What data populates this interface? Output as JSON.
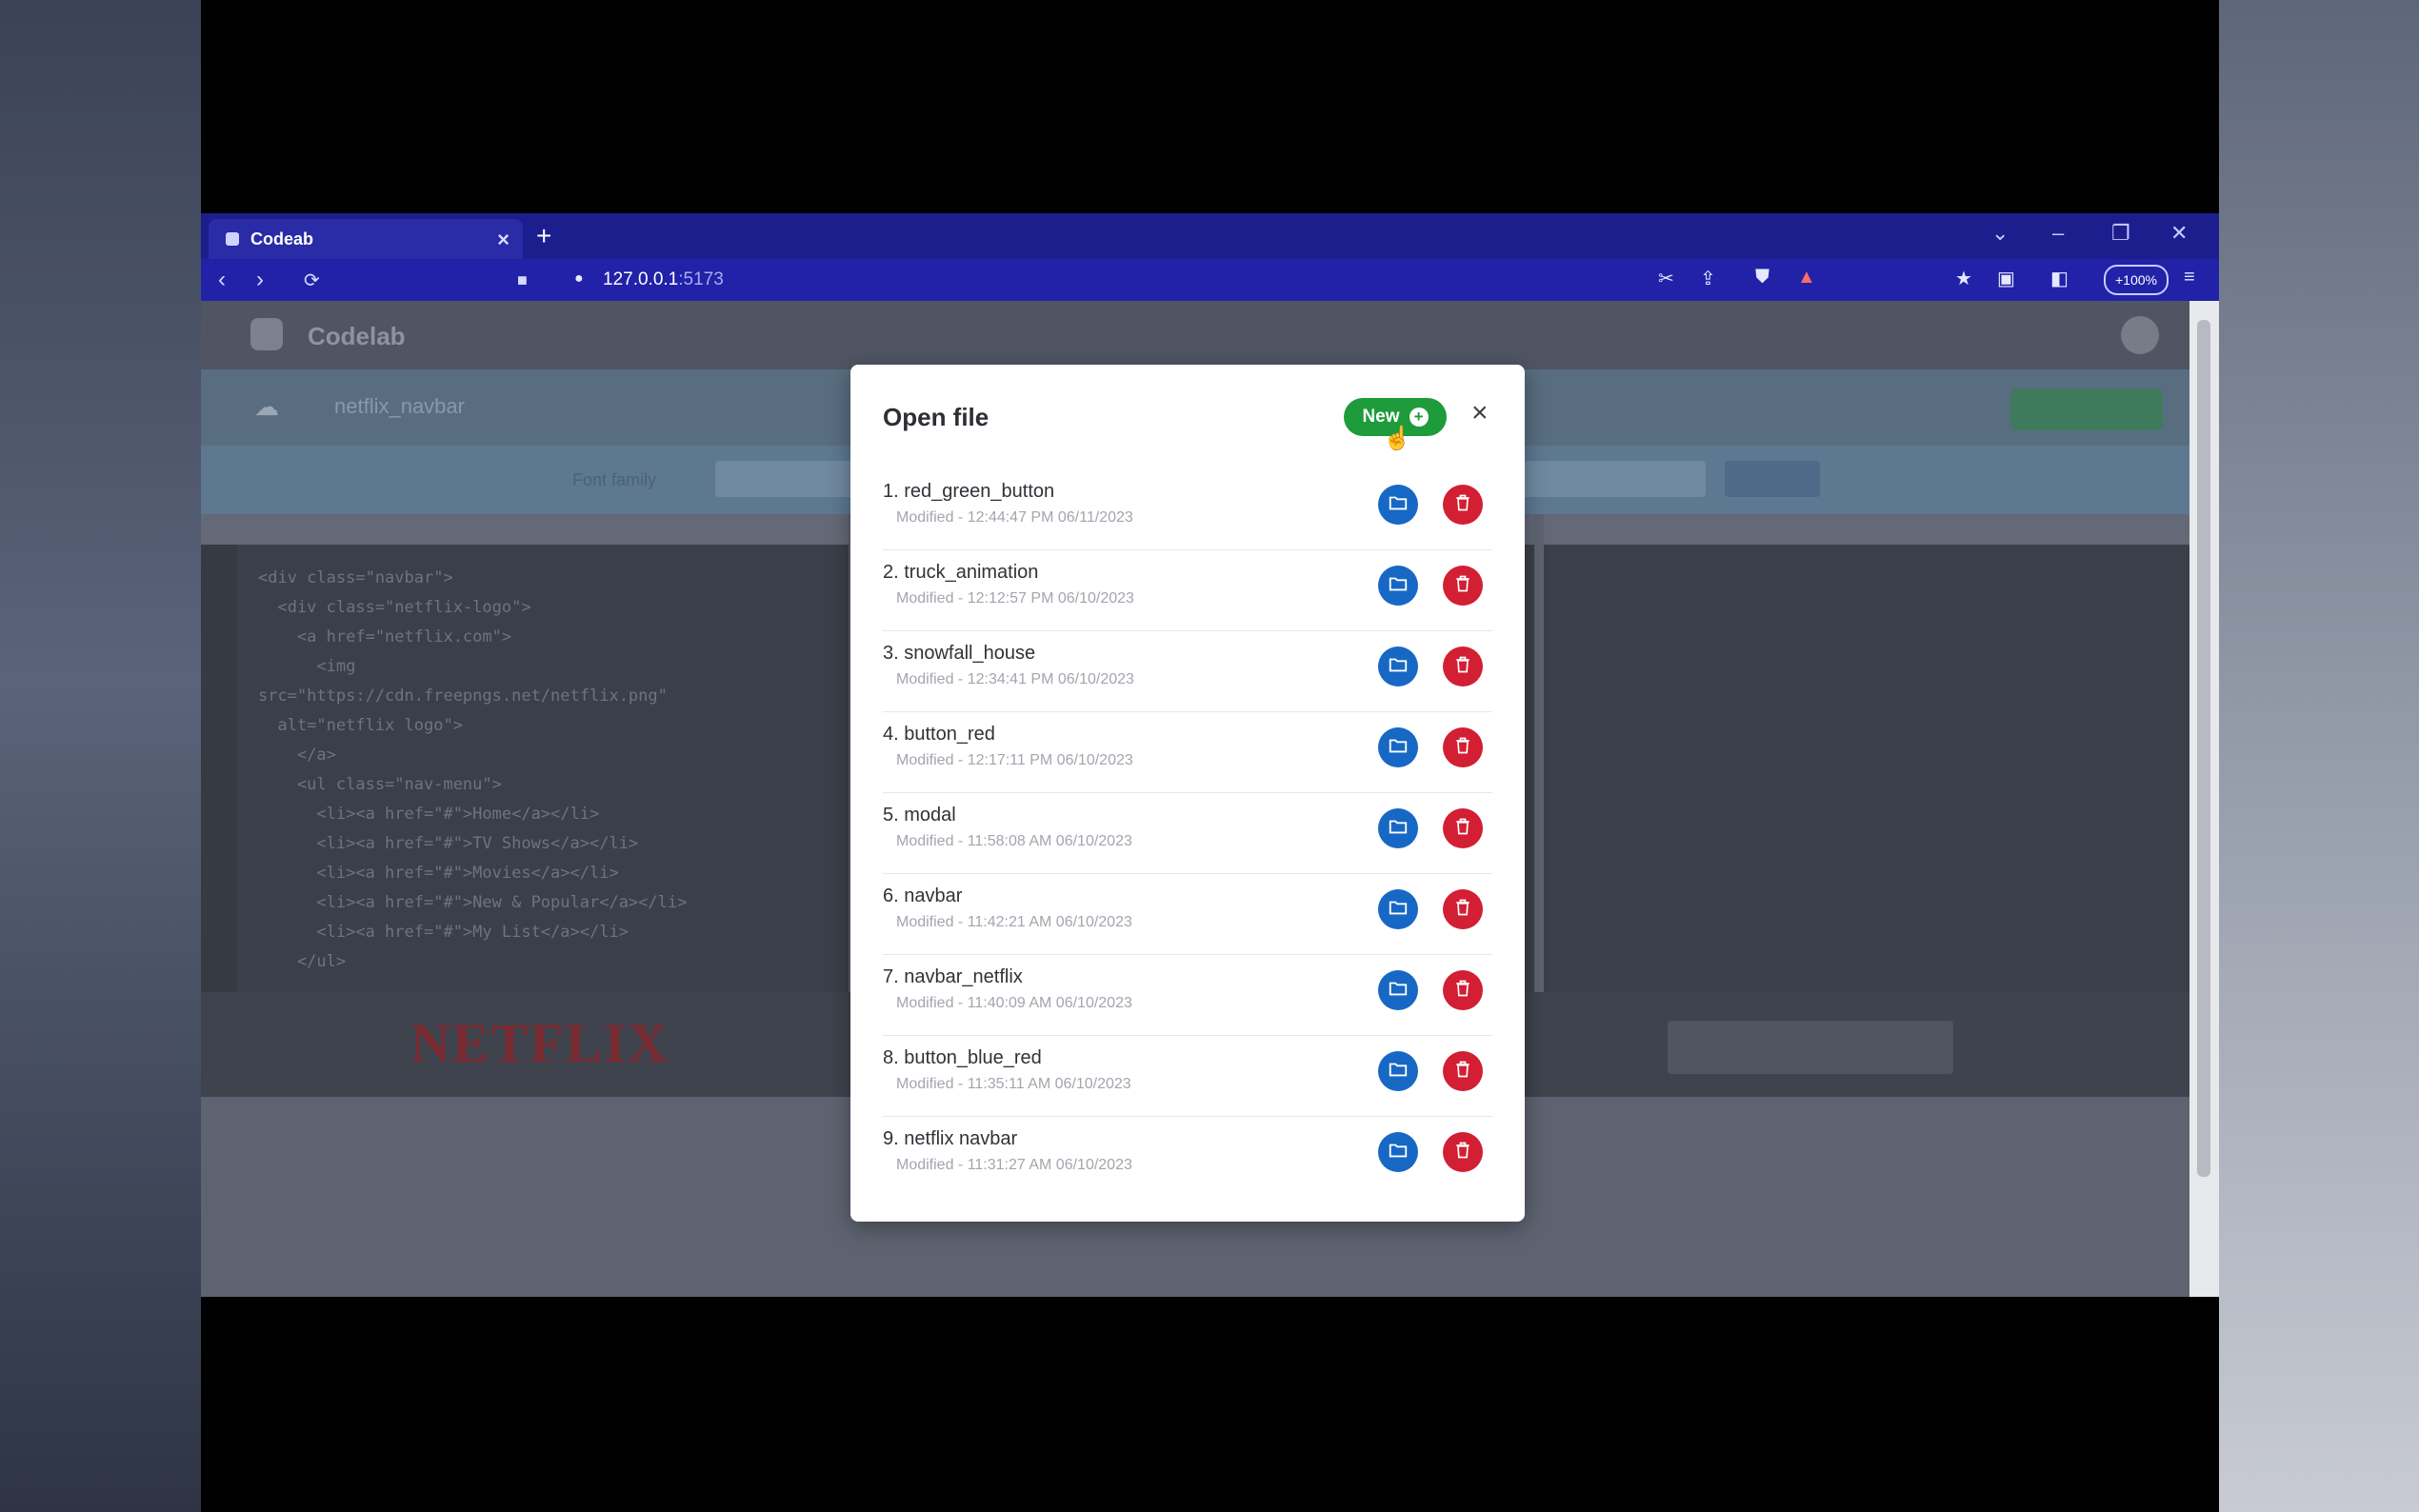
{
  "browser": {
    "tab_title": "Codeab",
    "url": "127.0.0.1",
    "url_rest": ":5173",
    "zoom": "+100%"
  },
  "app": {
    "name": "Codelab",
    "file_name": "netflix_navbar",
    "filter_label": "Font family",
    "code_lines": [
      "<div class=\"navbar\">",
      "  <div class=\"netflix-logo\">",
      "    <a href=\"netflix.com\">",
      "      <img",
      "src=\"https://cdn.freepngs.net/netflix.png\"",
      "  alt=\"netflix logo\">",
      "    </a>",
      "    <ul class=\"nav-menu\">",
      "      <li><a href=\"#\">Home</a></li>",
      "      <li><a href=\"#\">TV Shows</a></li>",
      "      <li><a href=\"#\">Movies</a></li>",
      "      <li><a href=\"#\">New & Popular</a></li>",
      "      <li><a href=\"#\">My List</a></li>",
      "    </ul>"
    ],
    "preview_logo": "NETFLIX"
  },
  "modal": {
    "title": "Open file",
    "new_label": "New",
    "close_symbol": "×",
    "files": [
      {
        "name": "1. red_green_button",
        "modified": "Modified - 12:44:47 PM 06/11/2023"
      },
      {
        "name": "2. truck_animation",
        "modified": "Modified - 12:12:57 PM 06/10/2023"
      },
      {
        "name": "3. snowfall_house",
        "modified": "Modified - 12:34:41 PM 06/10/2023"
      },
      {
        "name": "4. button_red",
        "modified": "Modified - 12:17:11 PM 06/10/2023"
      },
      {
        "name": "5. modal",
        "modified": "Modified - 11:58:08 AM 06/10/2023"
      },
      {
        "name": "6. navbar",
        "modified": "Modified - 11:42:21 AM 06/10/2023"
      },
      {
        "name": "7. navbar_netflix",
        "modified": "Modified - 11:40:09 AM 06/10/2023"
      },
      {
        "name": "8. button_blue_red",
        "modified": "Modified - 11:35:11 AM 06/10/2023"
      },
      {
        "name": "9. netflix navbar",
        "modified": "Modified - 11:31:27 AM 06/10/2023"
      }
    ]
  },
  "colors": {
    "new_button": "#1e9b3a",
    "open_button": "#1768c4",
    "delete_button": "#d21f33",
    "browser_chrome": "#1d1e8e"
  }
}
